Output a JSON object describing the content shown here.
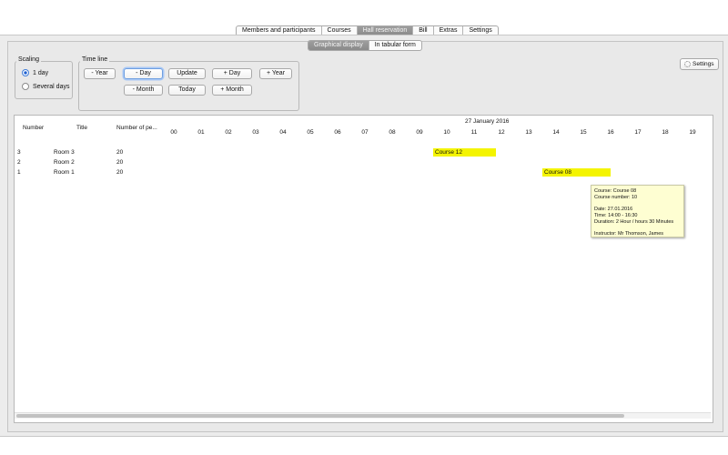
{
  "main_tabs": [
    {
      "label": "Members and participants",
      "selected": false
    },
    {
      "label": "Courses",
      "selected": false
    },
    {
      "label": "Hall reservation",
      "selected": true
    },
    {
      "label": "Bill",
      "selected": false
    },
    {
      "label": "Extras",
      "selected": false
    },
    {
      "label": "Settings",
      "selected": false
    }
  ],
  "view_tabs": [
    {
      "label": "Graphical display",
      "selected": true
    },
    {
      "label": "In tabular form",
      "selected": false
    }
  ],
  "scaling": {
    "title": "Scaling",
    "options": [
      {
        "label": "1 day",
        "selected": true
      },
      {
        "label": "Several days",
        "selected": false
      }
    ]
  },
  "timeline": {
    "title": "Time line",
    "buttons": {
      "minus_year": "- Year",
      "minus_day": "- Day",
      "update": "Update",
      "plus_day": "+ Day",
      "plus_year": "+ Year",
      "minus_month": "- Month",
      "today": "Today",
      "plus_month": "+ Month"
    }
  },
  "settings_button": "Settings",
  "schedule": {
    "date": "27 January 2016",
    "columns": {
      "number": "Number",
      "title": "Title",
      "persons": "Number of pe..."
    },
    "hours": [
      "00",
      "01",
      "02",
      "03",
      "04",
      "05",
      "06",
      "07",
      "08",
      "09",
      "10",
      "11",
      "12",
      "13",
      "14",
      "15",
      "16",
      "17",
      "18",
      "19"
    ],
    "rooms": [
      {
        "number": "3",
        "title": "Room 3",
        "persons": "20"
      },
      {
        "number": "2",
        "title": "Room 2",
        "persons": "20"
      },
      {
        "number": "1",
        "title": "Room 1",
        "persons": "20"
      }
    ],
    "reservations": [
      {
        "label": "Course 12",
        "room_row": 0,
        "start_hour": 10.0,
        "end_hour": 12.3
      },
      {
        "label": "Course 08",
        "room_row": 2,
        "start_hour": 14.0,
        "end_hour": 16.5
      }
    ]
  },
  "tooltip": {
    "course": "Course: Course 08",
    "course_number": "Course number: 10",
    "date": "Date: 27.01.2016",
    "time": "Time: 14:00 - 16:30",
    "duration": "Duration: 2 Hour / hours 30 Minutes",
    "instructor": "Instructor: Mr Thomson, James"
  },
  "colors": {
    "reservation": "#f4f400",
    "tooltip_bg": "#fefed2",
    "selected_tab": "#8f8f8f"
  }
}
